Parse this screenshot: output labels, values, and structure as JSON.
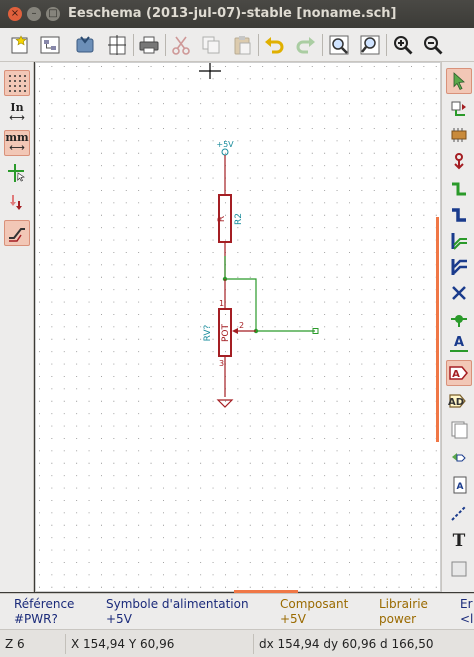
{
  "window": {
    "title": "Eeschema (2013-jul-07)-stable [noname.sch]",
    "close_glyph": "×",
    "min_glyph": "–",
    "max_glyph": "□"
  },
  "toolbar": {
    "icons": [
      "new-sheet-icon",
      "hierarchy-navigator-icon",
      "save-icon",
      "page-settings-icon",
      "print-icon",
      "cut-icon",
      "copy-icon",
      "paste-icon",
      "undo-icon",
      "redo-icon",
      "find-icon",
      "find-replace-icon",
      "zoom-in-icon",
      "zoom-out-icon"
    ]
  },
  "left_toolbar": {
    "units_inch": "In",
    "units_mm": "mm"
  },
  "schematic": {
    "power_label": "+5V",
    "resistor_value": "R",
    "resistor_ref": "R2",
    "pot_value": "POT",
    "pot_ref": "RV?",
    "pin_1": "1",
    "pin_2": "2",
    "pin_3": "3"
  },
  "right_toolbar": {
    "label_text_glyph": "A",
    "text_glyph": "T"
  },
  "info_panel": {
    "reference_label": "Référence",
    "reference_value": "#PWR?",
    "symbol_label": "Symbole d'alimentation",
    "symbol_value": "+5V",
    "component_label": "Composant",
    "component_value": "+5V",
    "library_label": "Librairie",
    "library_value": "power",
    "extra_label": "Er",
    "extra_value": "<l"
  },
  "status": {
    "zoom": "Z 6",
    "abs_coords": "X 154,94  Y 60,96",
    "rel_coords": "dx 154,94  dy 60,96  d 166,50"
  },
  "colors": {
    "wire": "#2a9a2a",
    "component": "#a41e23",
    "reference_text": "#1a8c9c",
    "power": "#a41e23",
    "grid": "#8a8a8a",
    "highlight": "#f07746"
  }
}
